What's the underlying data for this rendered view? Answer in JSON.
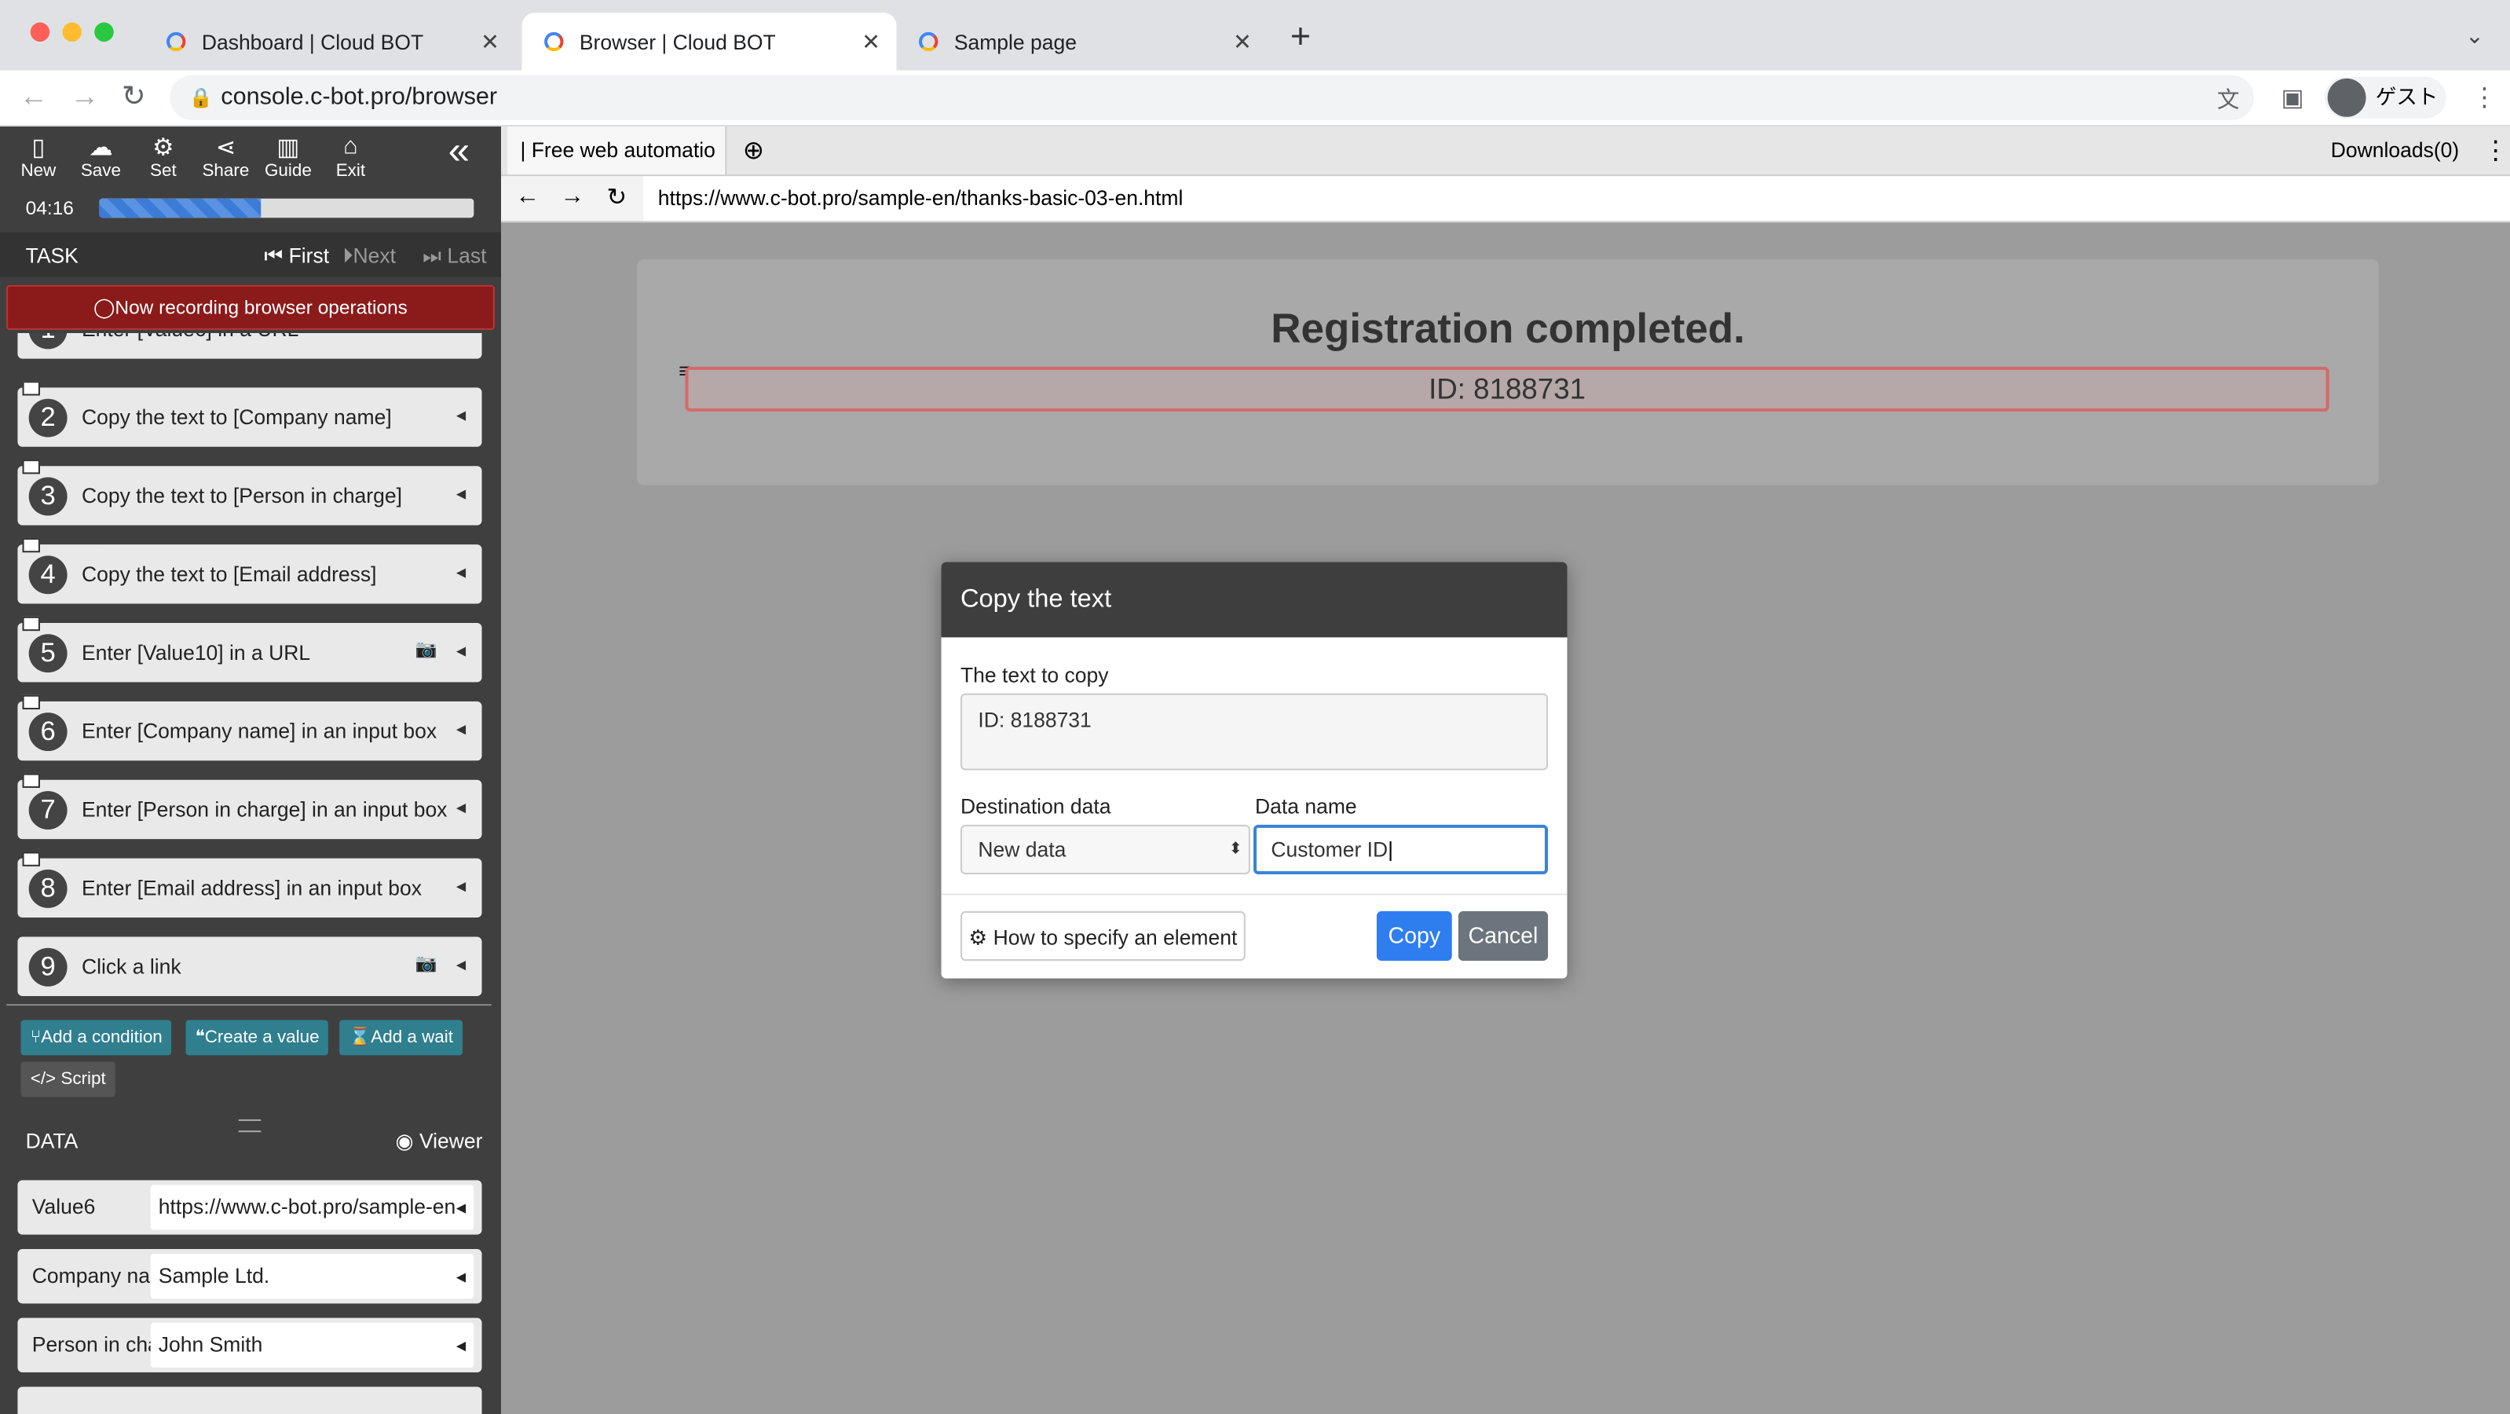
{
  "chrome": {
    "tabs": [
      {
        "title": "Dashboard | Cloud BOT",
        "active": false
      },
      {
        "title": "Browser | Cloud BOT",
        "active": true
      },
      {
        "title": "Sample page",
        "active": false
      }
    ],
    "address": "console.c-bot.pro/browser",
    "profile_label": "ゲスト"
  },
  "panel": {
    "tools": [
      {
        "label": "New",
        "icon": "file-icon"
      },
      {
        "label": "Save",
        "icon": "cloud-upload-icon"
      },
      {
        "label": "Set",
        "icon": "gear-icon"
      },
      {
        "label": "Share",
        "icon": "share-icon"
      },
      {
        "label": "Guide",
        "icon": "book-icon"
      },
      {
        "label": "Exit",
        "icon": "exit-icon"
      }
    ],
    "timer": "04:16",
    "progress": 0.43,
    "task_header": "TASK",
    "nav": {
      "first": "First",
      "next": "Next",
      "last": "Last"
    },
    "recording_text": "Now recording browser operations",
    "steps": [
      {
        "num": "1",
        "label": "Enter [Value6] in a URL"
      },
      {
        "num": "2",
        "label": "Copy the text to [Company name]"
      },
      {
        "num": "3",
        "label": "Copy the text to [Person in charge]"
      },
      {
        "num": "4",
        "label": "Copy the text to [Email address]"
      },
      {
        "num": "5",
        "label": "Enter [Value10] in a URL"
      },
      {
        "num": "6",
        "label": "Enter [Company name] in an input box"
      },
      {
        "num": "7",
        "label": "Enter [Person in charge] in an input box"
      },
      {
        "num": "8",
        "label": "Enter [Email address] in an input box"
      },
      {
        "num": "9",
        "label": "Click a link"
      }
    ],
    "actions": {
      "condition": "Add a condition",
      "value": "Create a value",
      "wait": "Add a wait",
      "script": "Script"
    },
    "data_header": "DATA",
    "viewer_label": "Viewer",
    "data_rows": [
      {
        "key": "Value6",
        "value": "https://www.c-bot.pro/sample-en"
      },
      {
        "key": "Company name",
        "value": "Sample Ltd."
      },
      {
        "key": "Person in charge",
        "value": "John Smith"
      }
    ]
  },
  "inner_browser": {
    "tab_title": "| Free web automatio",
    "downloads": "Downloads(0)",
    "url": "https://www.c-bot.pro/sample-en/thanks-basic-03-en.html",
    "heading": "Registration completed.",
    "id_text": "ID: 8188731"
  },
  "dialog": {
    "title": "Copy the text",
    "text_label": "The text to copy",
    "text_value": "ID: 8188731",
    "dest_label": "Destination data",
    "dest_value": "New data",
    "name_label": "Data name",
    "name_value": "Customer ID",
    "how_label": "How to specify an element",
    "copy_label": "Copy",
    "cancel_label": "Cancel"
  }
}
